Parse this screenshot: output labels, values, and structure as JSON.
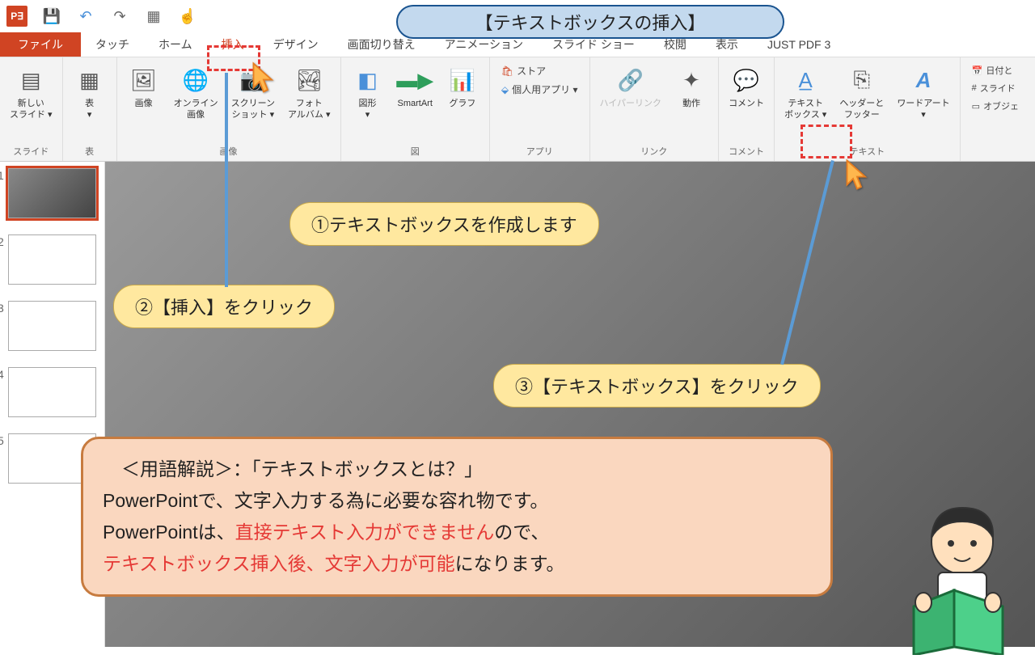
{
  "qat": {
    "save": "💾",
    "undo": "↶",
    "redo": "↷",
    "slideshow": "▦",
    "touch": "☝"
  },
  "tabs": {
    "file": "ファイル",
    "touch": "タッチ",
    "home": "ホーム",
    "insert": "挿入",
    "design": "デザイン",
    "transition": "画面切り替え",
    "animation": "アニメーション",
    "slideshow": "スライド ショー",
    "review": "校閲",
    "view": "表示",
    "justpdf": "JUST PDF 3"
  },
  "ribbon": {
    "groups": {
      "slides": {
        "label": "スライド",
        "newslide": "新しい\nスライド ▾"
      },
      "tables": {
        "label": "表",
        "table": "表\n▾"
      },
      "images": {
        "label": "画像",
        "pic": "画像",
        "online": "オンライン\n画像",
        "screenshot": "スクリーン\nショット ▾",
        "album": "フォト\nアルバム ▾"
      },
      "illust": {
        "label": "図",
        "shapes": "図形\n▾",
        "smartart": "SmartArt",
        "chart": "グラフ"
      },
      "apps": {
        "label": "アプリ",
        "store": "ストア",
        "myapps": "個人用アプリ ▾"
      },
      "links": {
        "label": "リンク",
        "hyperlink": "ハイパーリンク",
        "action": "動作"
      },
      "comments": {
        "label": "コメント",
        "comment": "コメント"
      },
      "text": {
        "label": "テキスト",
        "textbox": "テキスト\nボックス ▾",
        "headerfooter": "ヘッダーと\nフッター",
        "wordart": "ワードアート\n▾"
      },
      "extras": {
        "date": "日付と",
        "slidenum": "スライド",
        "object": "オブジェ"
      }
    }
  },
  "thumbs": [
    "1",
    "2",
    "3",
    "4",
    "5"
  ],
  "annotations": {
    "title": "【テキストボックスの挿入】",
    "step1": "①テキストボックスを作成します",
    "step2": "②【挿入】をクリック",
    "step3": "③【テキストボックス】をクリック",
    "explTitle": "＜用語解説＞：「テキストボックスとは？」",
    "explL1": "PowerPointで、文字入力する為に必要な容れ物です。",
    "explL2a": "PowerPointは、",
    "explL2b": "直接テキスト入力ができません",
    "explL2c": "ので、",
    "explL3a": "テキストボックス挿入後、文字入力が可能",
    "explL3b": "になります。"
  }
}
